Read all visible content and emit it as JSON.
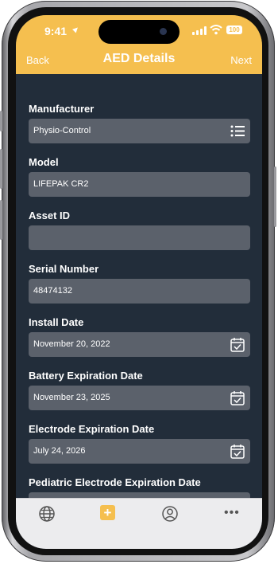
{
  "status_bar": {
    "time": "9:41",
    "battery": "100"
  },
  "nav": {
    "back_label": "Back",
    "title": "AED Details",
    "next_label": "Next"
  },
  "fields": [
    {
      "label": "Manufacturer",
      "value": "Physio-Control",
      "icon": "list-icon"
    },
    {
      "label": "Model",
      "value": "LIFEPAK CR2",
      "icon": ""
    },
    {
      "label": "Asset ID",
      "value": "",
      "icon": ""
    },
    {
      "label": "Serial Number",
      "value": "48474132",
      "icon": ""
    },
    {
      "label": "Install Date",
      "value": "November 20, 2022",
      "icon": "calendar-icon"
    },
    {
      "label": "Battery Expiration Date",
      "value": "November 23, 2025",
      "icon": "calendar-icon"
    },
    {
      "label": "Electrode Expiration Date",
      "value": "July 24, 2026",
      "icon": "calendar-icon"
    },
    {
      "label": "Pediatric Electrode Expiration Date",
      "value": "",
      "icon": "calendar-icon"
    }
  ],
  "tabbar": {
    "items": [
      "globe-icon",
      "add-icon",
      "person-icon",
      "more-icon"
    ]
  },
  "colors": {
    "accent": "#F5BF4F",
    "background": "#222D3A",
    "field": "#5B616B",
    "tabbar": "#ECECEE"
  }
}
